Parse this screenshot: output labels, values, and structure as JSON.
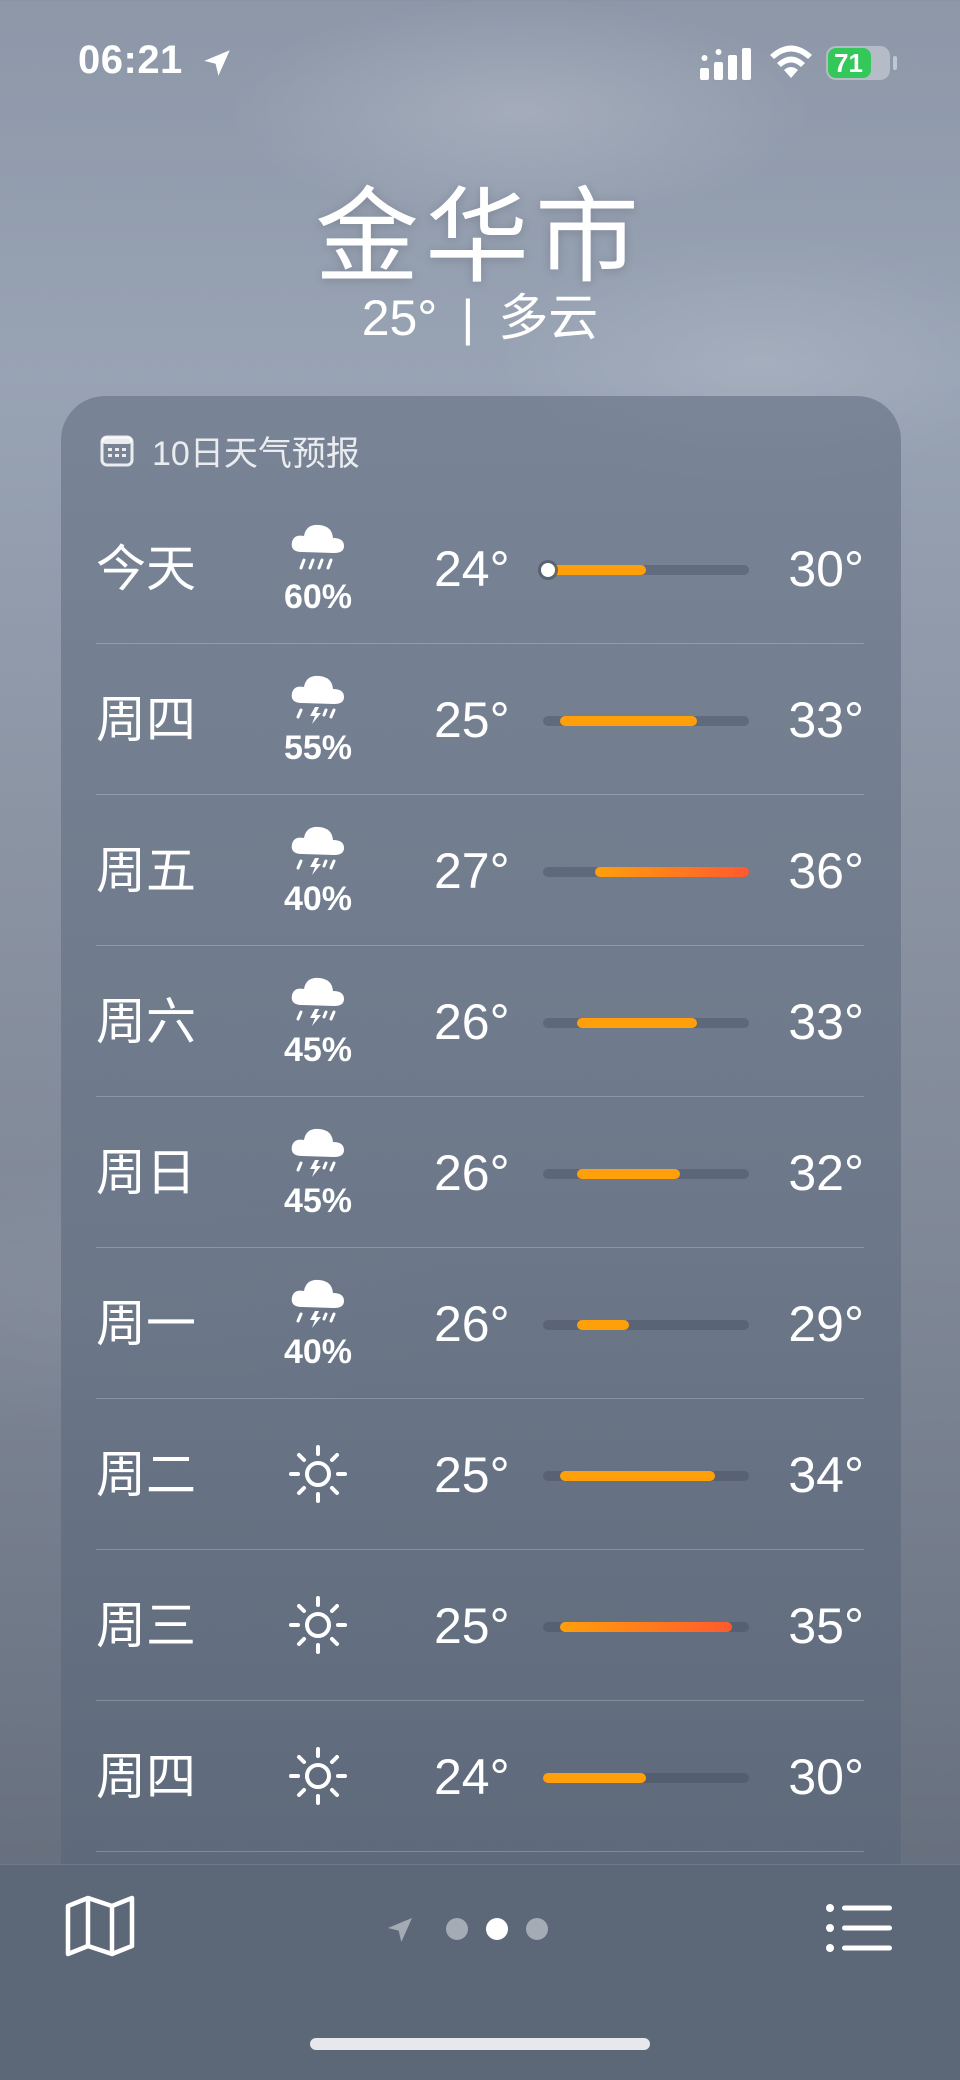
{
  "status_bar": {
    "time": "06:21",
    "battery": "71",
    "battery_level": 0.71,
    "battery_color": "#34c759"
  },
  "header": {
    "city": "金华市",
    "current_temp": "25°",
    "separator": "|",
    "condition": "多云"
  },
  "forecast": {
    "title": "10日天气预报",
    "icon": "calendar-icon",
    "range_min": 24,
    "range_max": 36,
    "current_temp": 25,
    "days": [
      {
        "day": "今天",
        "icon": "cloud-rain-icon",
        "pct": "60%",
        "lo": "24°",
        "hi": "30°",
        "lo_val": 24,
        "hi_val": 30,
        "current": true
      },
      {
        "day": "周四",
        "icon": "cloud-thunderstorm-icon",
        "pct": "55%",
        "lo": "25°",
        "hi": "33°",
        "lo_val": 25,
        "hi_val": 33
      },
      {
        "day": "周五",
        "icon": "cloud-thunderstorm-icon",
        "pct": "40%",
        "lo": "27°",
        "hi": "36°",
        "lo_val": 27,
        "hi_val": 36
      },
      {
        "day": "周六",
        "icon": "cloud-thunderstorm-icon",
        "pct": "45%",
        "lo": "26°",
        "hi": "33°",
        "lo_val": 26,
        "hi_val": 33
      },
      {
        "day": "周日",
        "icon": "cloud-thunderstorm-icon",
        "pct": "45%",
        "lo": "26°",
        "hi": "32°",
        "lo_val": 26,
        "hi_val": 32
      },
      {
        "day": "周一",
        "icon": "cloud-thunderstorm-icon",
        "pct": "40%",
        "lo": "26°",
        "hi": "29°",
        "lo_val": 26,
        "hi_val": 29
      },
      {
        "day": "周二",
        "icon": "sun-icon",
        "pct": "",
        "lo": "25°",
        "hi": "34°",
        "lo_val": 25,
        "hi_val": 34
      },
      {
        "day": "周三",
        "icon": "sun-icon",
        "pct": "",
        "lo": "25°",
        "hi": "35°",
        "lo_val": 25,
        "hi_val": 35
      },
      {
        "day": "周四",
        "icon": "sun-icon",
        "pct": "",
        "lo": "24°",
        "hi": "30°",
        "lo_val": 24,
        "hi_val": 30
      }
    ]
  },
  "colors": {
    "warm": "#ff9f0a",
    "hot": "#ff5a2e",
    "bar_track": "rgba(60,70,88,0.35)"
  },
  "bottom_bar": {
    "map_icon": "map-icon",
    "list_icon": "list-icon",
    "location_icon": "location-arrow-icon",
    "pages": 3,
    "active_page": 1
  }
}
